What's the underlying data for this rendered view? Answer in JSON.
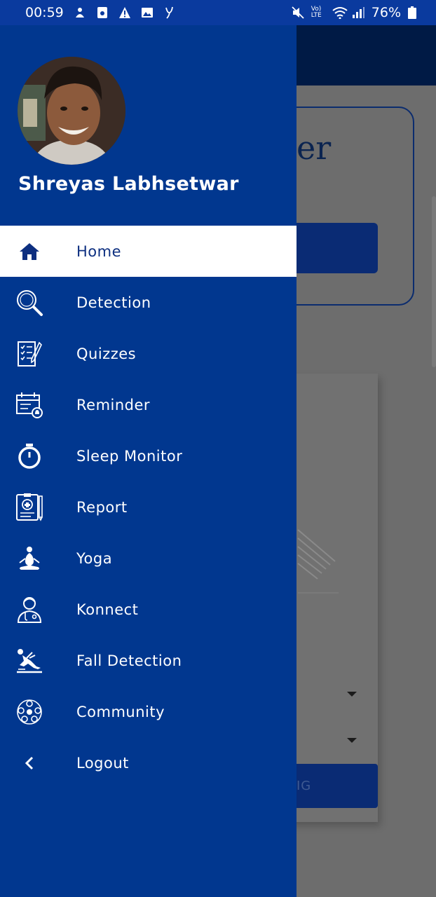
{
  "status_bar": {
    "time": "00:59",
    "battery": "76%",
    "volte": "Vo) LTE"
  },
  "drawer": {
    "user_name": "Shreyas Labhsetwar",
    "items": [
      {
        "label": "Home",
        "icon": "home-icon",
        "active": true
      },
      {
        "label": "Detection",
        "icon": "search-icon",
        "active": false
      },
      {
        "label": "Quizzes",
        "icon": "quiz-icon",
        "active": false
      },
      {
        "label": "Reminder",
        "icon": "reminder-icon",
        "active": false
      },
      {
        "label": "Sleep Monitor",
        "icon": "stopwatch-icon",
        "active": false
      },
      {
        "label": "Report",
        "icon": "report-icon",
        "active": false
      },
      {
        "label": "Yoga",
        "icon": "yoga-icon",
        "active": false
      },
      {
        "label": "Konnect",
        "icon": "doctor-icon",
        "active": false
      },
      {
        "label": "Fall Detection",
        "icon": "fall-icon",
        "active": false
      },
      {
        "label": "Community",
        "icon": "community-icon",
        "active": false
      },
      {
        "label": "Logout",
        "icon": "chevron-left-icon",
        "active": false
      }
    ]
  },
  "background": {
    "title_fragment": "er",
    "button_fragment": "IG"
  },
  "colors": {
    "drawer_bg": "#01378f",
    "active_bg": "#ffffff",
    "active_text": "#0d2f80",
    "dim_overlay": "#6d6d6d"
  }
}
